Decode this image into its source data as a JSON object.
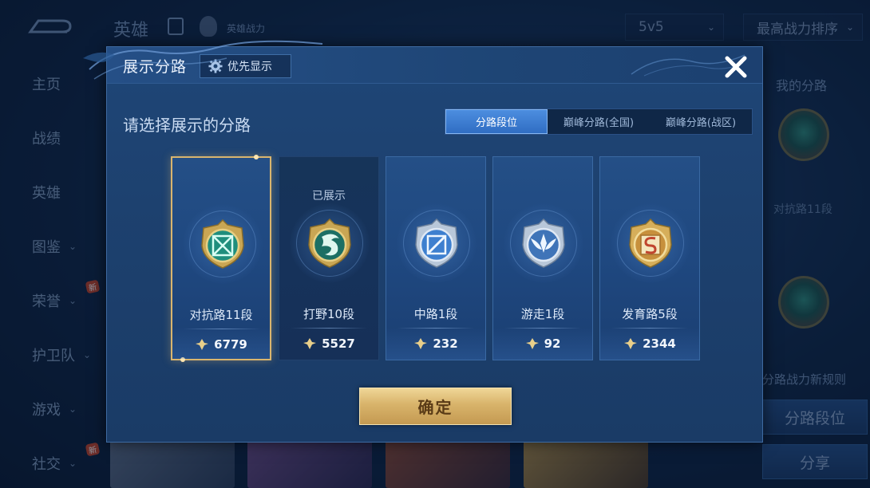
{
  "background": {
    "nav_items": [
      {
        "label": "主页",
        "chevron": false,
        "new": false
      },
      {
        "label": "战绩",
        "chevron": false,
        "new": false
      },
      {
        "label": "英雄",
        "chevron": false,
        "new": false
      },
      {
        "label": "图鉴",
        "chevron": true,
        "new": false
      },
      {
        "label": "荣誉",
        "chevron": true,
        "new": true
      },
      {
        "label": "护卫队",
        "chevron": true,
        "new": false
      },
      {
        "label": "游戏",
        "chevron": true,
        "new": false
      },
      {
        "label": "社交",
        "chevron": true,
        "new": true
      }
    ],
    "new_badge": "新",
    "hero_title": "英雄",
    "power_label": "英雄战力",
    "mode_dropdown": "5v5",
    "sort_dropdown": "最高战力排序",
    "my_lane_title": "我的分路",
    "my_lane_label": "对抗路11段",
    "rule_text": "分路战力新规则",
    "lane_rank_button": "分路段位",
    "share_button": "分享"
  },
  "modal": {
    "title": "展示分路",
    "priority_button": "优先显示",
    "prompt": "请选择展示的分路",
    "tabs": [
      {
        "label": "分路段位",
        "active": true
      },
      {
        "label": "巅峰分路(全国)",
        "active": false
      },
      {
        "label": "巅峰分路(战区)",
        "active": false
      }
    ],
    "lanes": [
      {
        "name": "对抗路11段",
        "power": "6779",
        "status": "",
        "selected": true,
        "emblem": "clash-lane-emblem-icon"
      },
      {
        "name": "打野10段",
        "power": "5527",
        "status": "已展示",
        "selected": false,
        "emblem": "jungle-emblem-icon"
      },
      {
        "name": "中路1段",
        "power": "232",
        "status": "",
        "selected": false,
        "emblem": "mid-lane-emblem-icon"
      },
      {
        "name": "游走1段",
        "power": "92",
        "status": "",
        "selected": false,
        "emblem": "roam-emblem-icon"
      },
      {
        "name": "发育路5段",
        "power": "2344",
        "status": "",
        "selected": false,
        "emblem": "farm-lane-emblem-icon"
      }
    ],
    "confirm_button": "确定"
  },
  "colors": {
    "modal_bg": "#1f4677",
    "accent_blue": "#3d7fd6",
    "gold": "#d8b36a",
    "selected_border": "#d9b56e"
  }
}
